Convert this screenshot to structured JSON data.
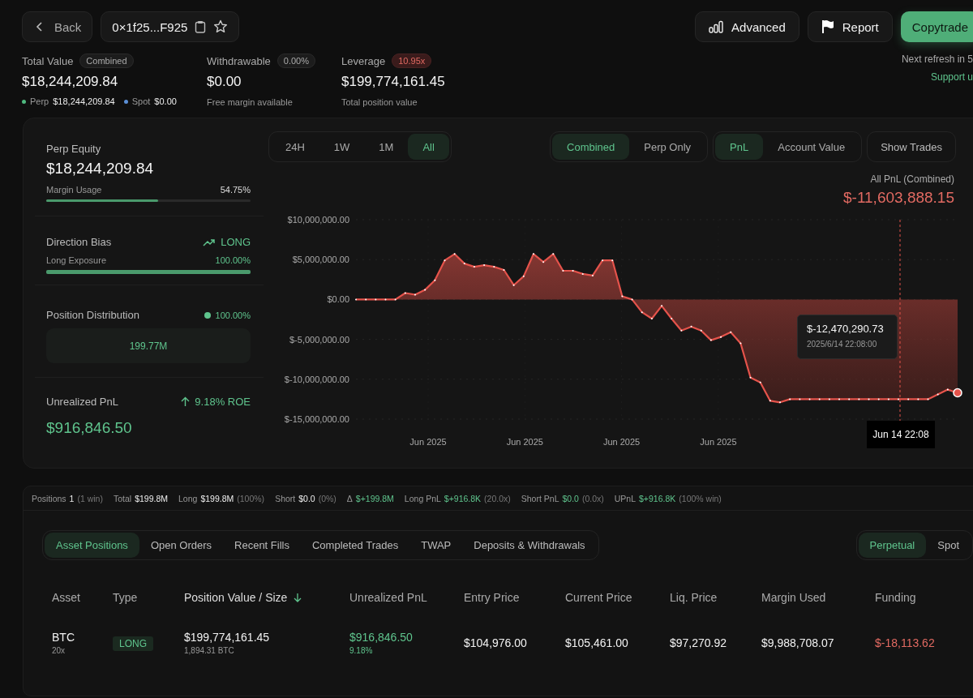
{
  "header": {
    "back_button": "Back",
    "address": "0×1f25...F925",
    "buttons": [
      {
        "label": "Advanced",
        "kind": "advanced"
      },
      {
        "label": "Report",
        "kind": "report"
      },
      {
        "label": "Copytrade",
        "kind": "copytrade"
      }
    ]
  },
  "stats": [
    {
      "label": "Total Value",
      "badge": "Combined",
      "alert": false,
      "value": "$18,244,209.84",
      "breakdown": [
        {
          "label": "Perp",
          "value": "$18,244,209.84",
          "color": "#4fb97f"
        },
        {
          "label": "Spot",
          "value": "$0.00",
          "color": "#5b8fd6"
        }
      ]
    },
    {
      "label": "Withdrawable",
      "badge": "0.00%",
      "alert": false,
      "value": "$0.00",
      "note": "Free margin available"
    },
    {
      "label": "Leverage",
      "badge": "10.95x",
      "alert": true,
      "value": "$199,774,161.45",
      "note": "Total position value"
    }
  ],
  "refresh": {
    "text": "Next refresh in 5",
    "link": "Support u"
  },
  "summary": {
    "perp_equity": {
      "label": "Perp Equity",
      "value": "$18,244,209.84",
      "meter_label": "Margin Usage",
      "reading": "54.75%",
      "level": 0.5475
    },
    "direction_bias": {
      "label": "Direction Bias",
      "direction": "LONG",
      "meter_label": "Long Exposure",
      "reading": "100.00%",
      "level": 1
    },
    "position_distribution": {
      "label": "Position Distribution",
      "reading": "100.00%",
      "bar_label": "199.77M"
    },
    "unrealized_pnl": {
      "label": "Unrealized PnL",
      "roe": "9.18% ROE",
      "value": "$916,846.50"
    }
  },
  "chart_panel": {
    "ranges": [
      {
        "label": "24H",
        "selected": false
      },
      {
        "label": "1W",
        "selected": false
      },
      {
        "label": "1M",
        "selected": false
      },
      {
        "label": "All",
        "selected": true
      }
    ],
    "scopes": [
      {
        "label": "Combined",
        "selected": true
      },
      {
        "label": "Perp Only",
        "selected": false
      }
    ],
    "metrics": [
      {
        "label": "PnL",
        "selected": true
      },
      {
        "label": "Account Value",
        "selected": false
      }
    ],
    "show_trades": "Show Trades",
    "caption": "All PnL (Combined)",
    "total": "$-11,603,888.15",
    "tooltip": {
      "value": "$-12,470,290.73",
      "time": "2025/6/14 22:08:00"
    },
    "crosshair_label": "Jun 14 22:08",
    "x_axis_labels": [
      "Jun 2025",
      "Jun 2025",
      "Jun 2025",
      "Jun 2025"
    ],
    "chart_data": {
      "type": "area",
      "grid": true,
      "ylim": [
        -15000000,
        10000000
      ],
      "yticks": [
        {
          "value": 10000000,
          "label": "$10,000,000.00"
        },
        {
          "value": 5000000,
          "label": "$5,000,000.00"
        },
        {
          "value": 0,
          "label": "$0.00"
        },
        {
          "value": -5000000,
          "label": "$-5,000,000.00"
        },
        {
          "value": -10000000,
          "label": "$-10,000,000.00"
        },
        {
          "value": -15000000,
          "label": "$-15,000,000.00"
        }
      ],
      "series": [
        {
          "color": "#e5534b",
          "values": [
            0,
            0,
            0,
            0,
            0,
            800000,
            600000,
            1200000,
            2400000,
            4900000,
            5700000,
            4500000,
            4100000,
            4300000,
            4100000,
            3700000,
            1800000,
            2900000,
            5700000,
            4700000,
            5700000,
            3600000,
            3600000,
            3200000,
            3000000,
            4900000,
            4900000,
            400000,
            0,
            -1600000,
            -2400000,
            -800000,
            -2400000,
            -3900000,
            -3400000,
            -3900000,
            -5100000,
            -4700000,
            -4100000,
            -5500000,
            -9800000,
            -10400000,
            -12700000,
            -12900000,
            -12500000,
            -12500000,
            -12500000,
            -12500000,
            -12500000,
            -12500000,
            -12500000,
            -12500000,
            -12500000,
            -12500000,
            -12500000,
            -12500000,
            -12500000,
            -12500000,
            -12500000,
            -11900000,
            -11300000,
            -11700000
          ]
        }
      ]
    }
  },
  "positions_summary": [
    {
      "label": "Positions",
      "value": "1",
      "note": "(1 win)",
      "positive": false
    },
    {
      "label": "Total",
      "value": "$199.8M",
      "positive": false
    },
    {
      "label": "Long",
      "value": "$199.8M",
      "note": "(100%)",
      "positive": false
    },
    {
      "label": "Short",
      "value": "$0.0",
      "note": "(0%)",
      "positive": false
    },
    {
      "label": "Δ",
      "value": "$+199.8M",
      "positive": true
    },
    {
      "label": "Long PnL",
      "value": "$+916.8K",
      "note": "(20.0x)",
      "positive": true
    },
    {
      "label": "Short PnL",
      "value": "$0.0",
      "note": "(0.0x)",
      "positive": true
    },
    {
      "label": "UPnL",
      "value": "$+916.8K",
      "note": "(100% win)",
      "positive": true
    }
  ],
  "tabs": [
    {
      "label": "Asset Positions",
      "selected": true
    },
    {
      "label": "Open Orders",
      "selected": false
    },
    {
      "label": "Recent Fills",
      "selected": false
    },
    {
      "label": "Completed Trades",
      "selected": false
    },
    {
      "label": "TWAP",
      "selected": false
    },
    {
      "label": "Deposits & Withdrawals",
      "selected": false
    }
  ],
  "market_tabs": [
    {
      "label": "Perpetual",
      "selected": true
    },
    {
      "label": "Spot",
      "selected": false
    }
  ],
  "table": {
    "columns": [
      {
        "label": "Asset",
        "sorted": false
      },
      {
        "label": "Type",
        "sorted": false
      },
      {
        "label": "Position Value / Size",
        "sorted": true
      },
      {
        "label": "Unrealized PnL",
        "sorted": false
      },
      {
        "label": "Entry Price",
        "sorted": false
      },
      {
        "label": "Current Price",
        "sorted": false
      },
      {
        "label": "Liq. Price",
        "sorted": false
      },
      {
        "label": "Margin Used",
        "sorted": false
      },
      {
        "label": "Funding",
        "sorted": false
      }
    ],
    "rows": [
      {
        "asset": "BTC",
        "leverage": "20x",
        "side": "LONG",
        "is_long": true,
        "value": "$199,774,161.45",
        "size": "1,894.31 BTC",
        "pnl": "$916,846.50",
        "roe": "9.18%",
        "pnl_gain": true,
        "entry": "$104,976.00",
        "current": "$105,461.00",
        "liq": "$97,270.92",
        "margin": "$9,988,708.07",
        "funding": "$-18,113.62",
        "funding_gain": false
      }
    ]
  }
}
